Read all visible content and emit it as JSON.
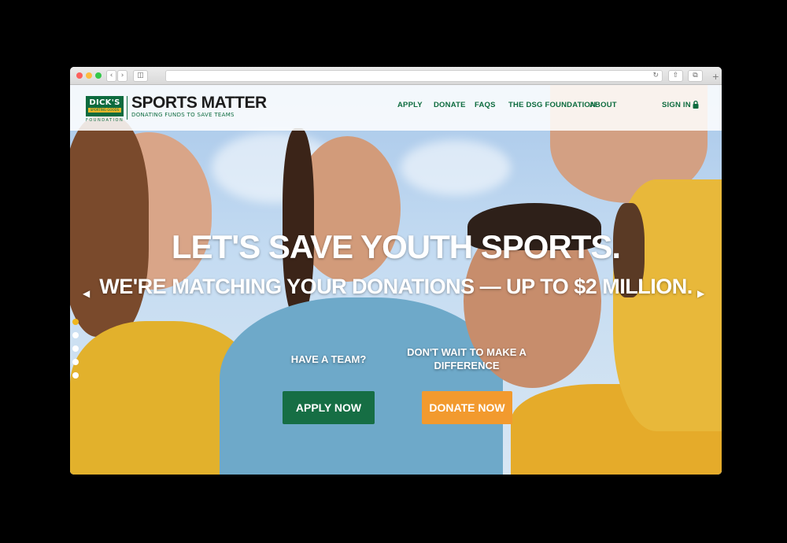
{
  "header": {
    "logo_main": "DICK'S",
    "logo_sub": "SPORTING GOODS",
    "logo_foundation": "FOUNDATION",
    "brand_title": "SPORTS MATTER",
    "brand_tagline": "DONATING FUNDS TO SAVE TEAMS",
    "nav": [
      "APPLY",
      "DONATE",
      "FAQS",
      "THE DSG FOUNDATION",
      "ABOUT"
    ],
    "sign_in": "SIGN IN |"
  },
  "hero": {
    "headline": "LET'S SAVE YOUTH SPORTS.",
    "subheadline": "WE'RE MATCHING YOUR DONATIONS — UP TO $2 MILLION.",
    "left_arrow": "◀",
    "right_arrow": "▶",
    "slides": 5,
    "active_slide": 1,
    "team_label": "HAVE A TEAM?",
    "donate_label": "DON'T WAIT TO MAKE A DIFFERENCE",
    "apply_button": "APPLY NOW",
    "donate_button": "DONATE NOW"
  },
  "colors": {
    "brand_green": "#0d6b3e",
    "apply_green": "#166e44",
    "donate_orange": "#f29a2e",
    "active_dot": "#f0b71f"
  }
}
